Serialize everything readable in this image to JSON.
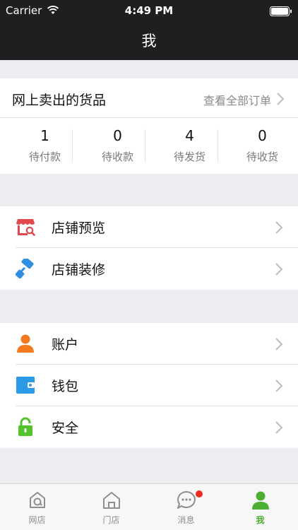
{
  "status_bar": {
    "carrier": "Carrier",
    "time": "4:49 PM"
  },
  "nav": {
    "title": "我"
  },
  "orders": {
    "title": "网上卖出的货品",
    "view_all": "查看全部订单",
    "stats": [
      {
        "count": "1",
        "label": "待付款"
      },
      {
        "count": "0",
        "label": "待收款"
      },
      {
        "count": "4",
        "label": "待发货"
      },
      {
        "count": "0",
        "label": "待收货"
      }
    ]
  },
  "shop_menu": [
    {
      "label": "店铺预览",
      "icon": "shop-preview-icon"
    },
    {
      "label": "店铺装修",
      "icon": "paint-roller-icon"
    }
  ],
  "account_menu": [
    {
      "label": "账户",
      "icon": "user-icon"
    },
    {
      "label": "钱包",
      "icon": "wallet-icon"
    },
    {
      "label": "安全",
      "icon": "lock-icon"
    }
  ],
  "tabs": [
    {
      "label": "网店",
      "icon": "online-shop-icon",
      "active": false
    },
    {
      "label": "门店",
      "icon": "store-icon",
      "active": false
    },
    {
      "label": "消息",
      "icon": "message-icon",
      "active": false,
      "badge": true
    },
    {
      "label": "我",
      "icon": "profile-icon",
      "active": true
    }
  ],
  "colors": {
    "header": "#1d1f20",
    "active_tab": "#4caf32",
    "badge": "#f02c21",
    "shop_preview": "#e2474c",
    "paint_roller": "#2f8fe0",
    "user": "#f47a20",
    "wallet": "#2b9be8",
    "lock": "#53c22b"
  }
}
